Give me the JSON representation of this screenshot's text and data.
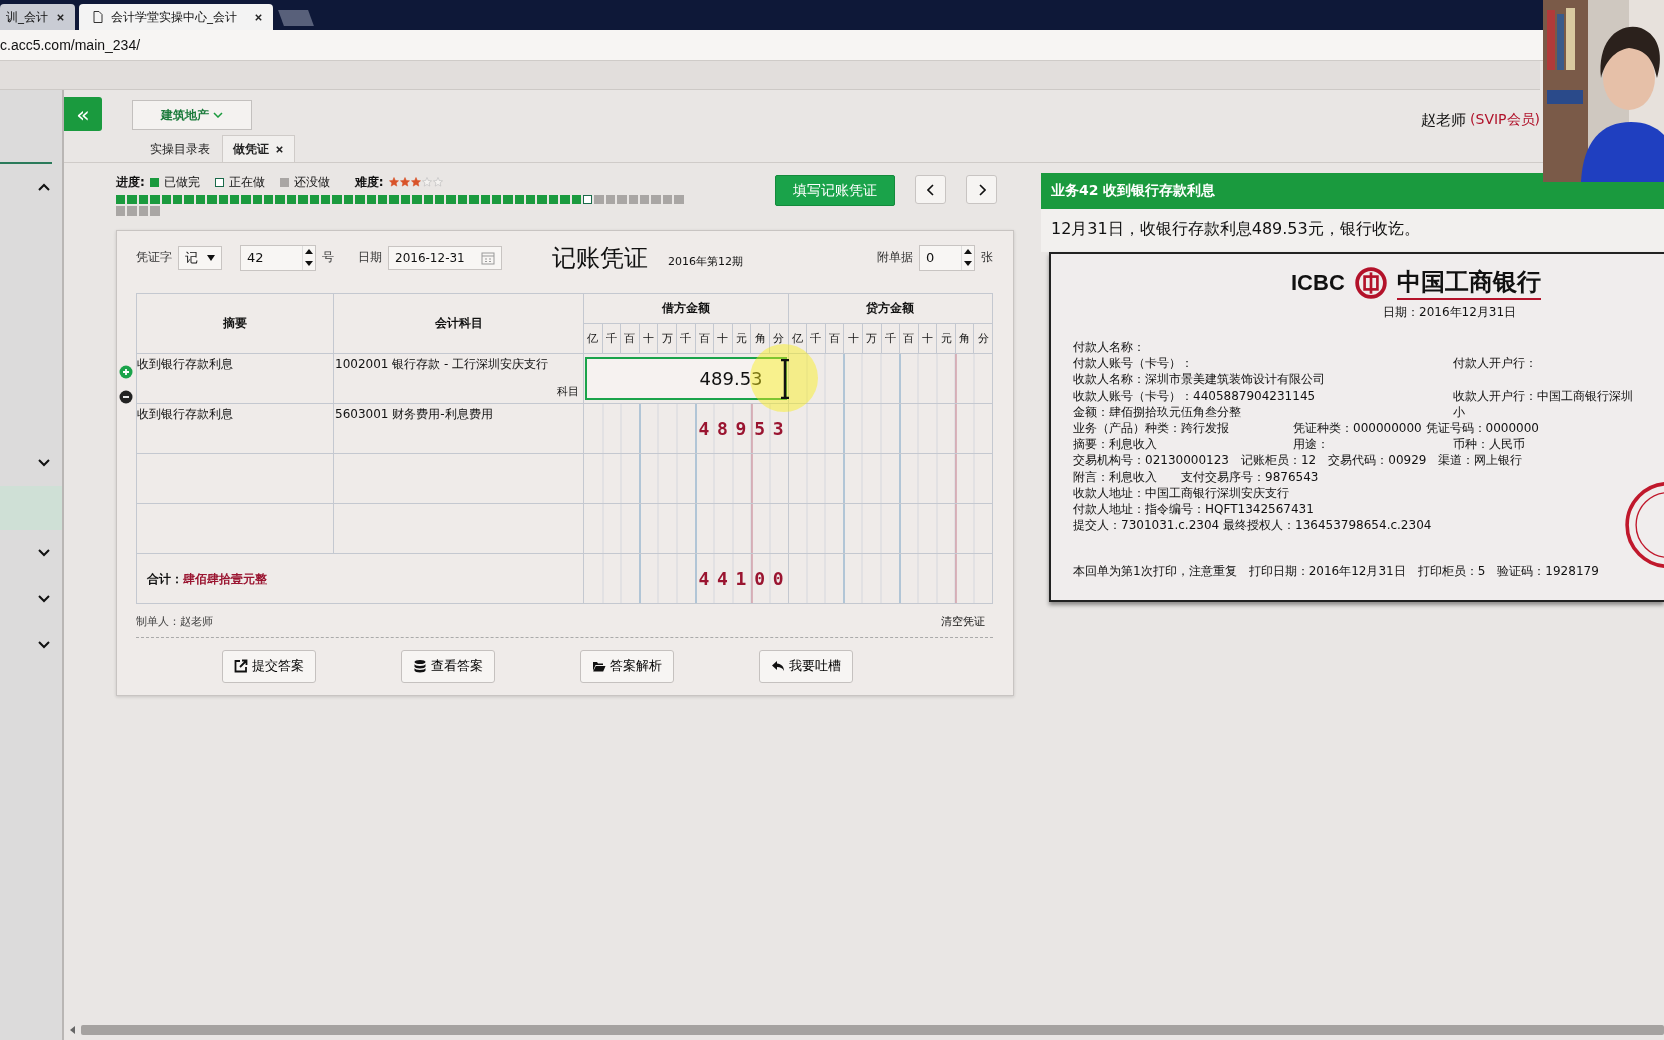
{
  "browser": {
    "tabs": [
      {
        "title": "训_会计",
        "selected": false
      },
      {
        "title": "会计学堂实操中心_会计",
        "selected": true
      }
    ],
    "url": "c.acc5.com/main_234/"
  },
  "sidebar": {
    "entries": [
      {
        "kind": "section",
        "expanded": true
      },
      {
        "kind": "section",
        "expanded": false
      },
      {
        "kind": "item",
        "selected": true
      },
      {
        "kind": "section",
        "expanded": false
      },
      {
        "kind": "section",
        "expanded": false
      },
      {
        "kind": "section",
        "expanded": false
      }
    ]
  },
  "header": {
    "collapse": "«",
    "industry": "建筑地产",
    "user": "赵老师",
    "membership": "(SVIP会员)"
  },
  "app_tabs": [
    {
      "label": "实操目录表",
      "selected": false,
      "closable": false
    },
    {
      "label": "做凭证",
      "selected": true,
      "closable": true
    }
  ],
  "progress": {
    "label": "进度:",
    "legend": [
      {
        "kind": "done",
        "label": "已做完"
      },
      {
        "kind": "current",
        "label": "正在做"
      },
      {
        "kind": "todo",
        "label": "还没做"
      }
    ],
    "difficulty_label": "难度:",
    "stars": 3,
    "steps": [
      {
        "kind": "done"
      },
      {
        "kind": "done"
      },
      {
        "kind": "done"
      },
      {
        "kind": "done"
      },
      {
        "kind": "done"
      },
      {
        "kind": "done"
      },
      {
        "kind": "done"
      },
      {
        "kind": "done"
      },
      {
        "kind": "done"
      },
      {
        "kind": "done"
      },
      {
        "kind": "done"
      },
      {
        "kind": "done"
      },
      {
        "kind": "done"
      },
      {
        "kind": "done"
      },
      {
        "kind": "done"
      },
      {
        "kind": "done"
      },
      {
        "kind": "done"
      },
      {
        "kind": "done"
      },
      {
        "kind": "done"
      },
      {
        "kind": "done"
      },
      {
        "kind": "done"
      },
      {
        "kind": "done"
      },
      {
        "kind": "done"
      },
      {
        "kind": "done"
      },
      {
        "kind": "done"
      },
      {
        "kind": "done"
      },
      {
        "kind": "done"
      },
      {
        "kind": "done"
      },
      {
        "kind": "done"
      },
      {
        "kind": "done"
      },
      {
        "kind": "done"
      },
      {
        "kind": "done"
      },
      {
        "kind": "done"
      },
      {
        "kind": "done"
      },
      {
        "kind": "done"
      },
      {
        "kind": "done"
      },
      {
        "kind": "done"
      },
      {
        "kind": "done"
      },
      {
        "kind": "done"
      },
      {
        "kind": "done"
      },
      {
        "kind": "done"
      },
      {
        "kind": "current"
      },
      {
        "kind": "todo"
      },
      {
        "kind": "todo"
      },
      {
        "kind": "todo"
      },
      {
        "kind": "todo"
      },
      {
        "kind": "todo"
      },
      {
        "kind": "todo"
      },
      {
        "kind": "todo"
      },
      {
        "kind": "todo"
      },
      {
        "kind": "todo"
      },
      {
        "kind": "todo"
      },
      {
        "kind": "todo"
      },
      {
        "kind": "todo"
      }
    ]
  },
  "fill_button": "填写记账凭证",
  "voucher": {
    "word_label": "凭证字",
    "word": "记",
    "number": "42",
    "number_unit": "号",
    "date_label": "日期",
    "date": "2016-12-31",
    "title": "记账凭证",
    "period": "2016年第12期",
    "attach_label": "附单据",
    "attach": "0",
    "attach_unit": "张",
    "columns": {
      "summary": "摘要",
      "subject": "会计科目",
      "debit": "借方金额",
      "credit": "贷方金额",
      "debit_units": [
        "亿",
        "千",
        "百",
        "十",
        "万",
        "千",
        "百",
        "十",
        "元",
        "角",
        "分"
      ],
      "credit_units": [
        "亿",
        "千",
        "百",
        "十",
        "万",
        "千",
        "百",
        "十",
        "元",
        "角",
        "分"
      ]
    },
    "rows": [
      {
        "kind": "editing",
        "summary": "收到银行存款利息",
        "subject": "1002001 银行存款 - 工行深圳安庆支行",
        "hint": "科目",
        "debit": "489.53"
      },
      {
        "kind": "entry",
        "summary": "收到银行存款利息",
        "subject": "5603001 财务费用-利息费用",
        "debit": "48953"
      },
      {
        "kind": "blank"
      },
      {
        "kind": "blank"
      }
    ],
    "total": {
      "label": "合计：",
      "words": "肆佰肆拾壹元整",
      "debit": "44100"
    },
    "maker": "制单人：赵老师",
    "clear": "清空凭证",
    "actions": [
      {
        "kind": "share",
        "label": "提交答案"
      },
      {
        "kind": "database",
        "label": "查看答案"
      },
      {
        "kind": "folder",
        "label": "答案解析"
      },
      {
        "kind": "reply",
        "label": "我要吐槽"
      }
    ]
  },
  "task": {
    "title": "业务42 收到银行存款利息",
    "description": "12月31日，收银行存款利息489.53元，银行收讫。",
    "receipt": {
      "logo": "ICBC",
      "bank": "中国工商银行",
      "date": "日期：2016年12月31日",
      "lines": [
        {
          "left": "付款人名称："
        },
        {
          "left": "付款人账号（卡号）：",
          "right": "付款人开户行："
        },
        {
          "left": "收款人名称：深圳市景美建筑装饰设计有限公司"
        },
        {
          "left": "收款人账号（卡号）：4405887904231145",
          "right": "收款人开户行：中国工商银行深圳"
        },
        {
          "left": "金额：肆佰捌拾玖元伍角叁分整",
          "right": "小"
        },
        {
          "left": "业务（产品）种类：跨行发报",
          "middle": "凭证种类：000000000 凭证号码：0000000"
        },
        {
          "left": "摘要：利息收入",
          "middle": "用途：",
          "right": "币种：人民币"
        },
        {
          "left": "交易机构号：02130000123　记账柜员：12　交易代码：00929　渠道：网上银行"
        },
        {
          "left": "附言：利息收入　　支付交易序号：9876543"
        },
        {
          "left": "收款人地址：中国工商银行深圳安庆支行"
        },
        {
          "left": "付款人地址：指令编号：HQFT1342567431"
        },
        {
          "left": "提交人：7301031.c.2304 最终授权人：136453798654.c.2304"
        }
      ],
      "footer": "本回单为第1次打印，注意重复　打印日期：2016年12月31日　打印柜员：5　验证码：1928179"
    }
  }
}
